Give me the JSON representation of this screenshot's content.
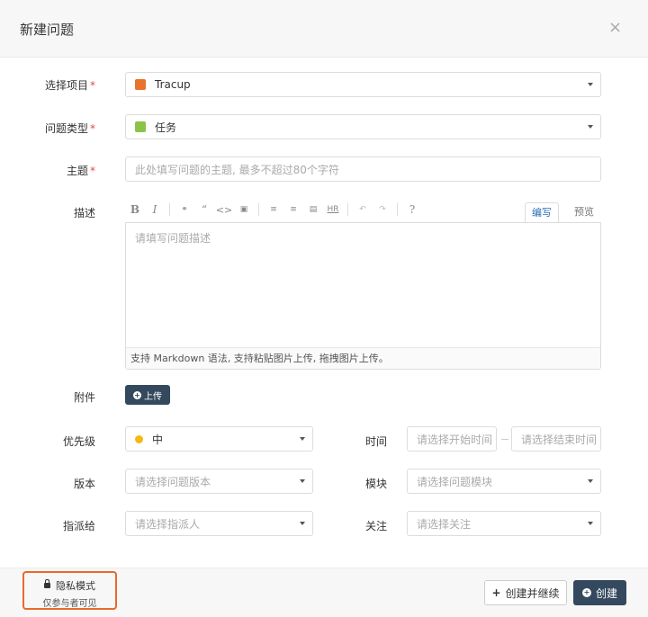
{
  "header": {
    "title": "新建问题",
    "close": "×"
  },
  "form": {
    "project": {
      "label": "选择项目",
      "value": "Tracup",
      "swatch_color": "#e8732d"
    },
    "issue_type": {
      "label": "问题类型",
      "value": "任务",
      "swatch_color": "#8bc34a"
    },
    "subject": {
      "label": "主题",
      "placeholder": "此处填写问题的主题, 最多不超过80个字符"
    },
    "description": {
      "label": "描述",
      "toolbar": [
        "B",
        "I",
        "link",
        "“",
        "<>",
        "image",
        "ordered-list",
        "unordered-list",
        "table",
        "HR",
        "undo",
        "redo",
        "?"
      ],
      "tabs": [
        "编写",
        "预览"
      ],
      "placeholder": "请填写问题描述",
      "hint": "支持 Markdown 语法, 支持粘贴图片上传, 拖拽图片上传。"
    },
    "attachment": {
      "label": "附件",
      "button": "上传"
    },
    "priority": {
      "label": "优先级",
      "value": "中",
      "dot_color": "#f5b90f"
    },
    "time": {
      "label": "时间",
      "start_placeholder": "请选择开始时间",
      "end_placeholder": "请选择结束时间"
    },
    "version": {
      "label": "版本",
      "placeholder": "请选择问题版本"
    },
    "module": {
      "label": "模块",
      "placeholder": "请选择问题模块"
    },
    "assignee": {
      "label": "指派给",
      "placeholder": "请选择指派人"
    },
    "follow": {
      "label": "关注",
      "placeholder": "请选择关注"
    }
  },
  "footer": {
    "privacy_title": "隐私模式",
    "privacy_sub": "仅参与者可见",
    "create_continue": "创建并继续",
    "create": "创建"
  },
  "colors": {
    "primary": "#34495e",
    "required": "#e24a4a",
    "privacy_border": "#e8692b",
    "active_tab": "#2a6fb5"
  }
}
